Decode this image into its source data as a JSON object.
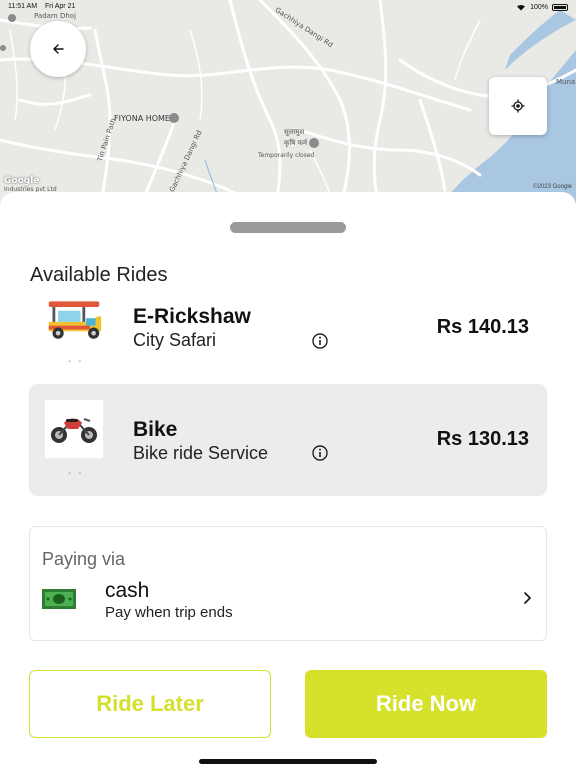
{
  "status_bar": {
    "time": "11:51 AM",
    "date": "Fri Apr 21",
    "battery": "100%"
  },
  "map": {
    "labels": {
      "padam_dhoj": "Padam Dhoj",
      "gachhiya_dangi_rd_top": "Gachhiya Dangi Rd",
      "fiyona_home": "FIYONA HOME",
      "tin_pain_path": "Tin Pain Path",
      "gachhiya_dangi_rd_mid": "Gachhiya Dangi Rd",
      "sulamus": "सुलामुस",
      "krishi_farm": "कृषि फर्म",
      "temporarily_closed": "Temporarily closed",
      "muna": "Muna",
      "industries": "Industries pvt Ltd",
      "google": "Google",
      "copyright": "©2023 Google"
    }
  },
  "section_title": "Available Rides",
  "rides": [
    {
      "name": "E-Rickshaw",
      "subtitle": "City Safari",
      "price": "Rs 140.13",
      "dots": "- -",
      "icon": "e-rickshaw-icon",
      "selected": false
    },
    {
      "name": "Bike",
      "subtitle": "Bike ride Service",
      "price": "Rs 130.13",
      "dots": "- -",
      "icon": "motorbike-icon",
      "selected": true
    }
  ],
  "payment": {
    "title": "Paying via",
    "method": "cash",
    "subtitle": "Pay when trip ends",
    "icon": "cash-icon"
  },
  "buttons": {
    "later": "Ride Later",
    "now": "Ride Now"
  },
  "colors": {
    "accent": "#d5e12a",
    "selected_bg": "#ececec",
    "water": "#a9c7e3",
    "map_bg": "#e9e9e6"
  }
}
